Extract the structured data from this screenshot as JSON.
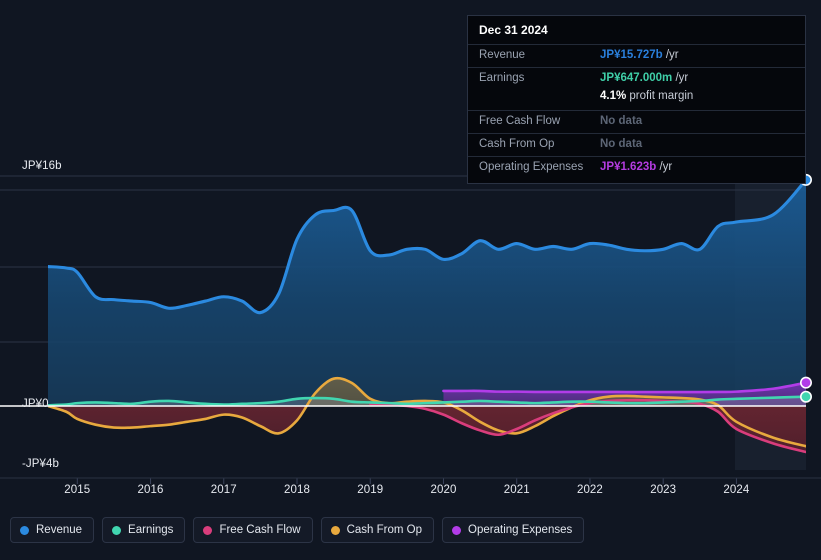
{
  "tooltip": {
    "title": "Dec 31 2024",
    "rows": [
      {
        "key": "Revenue",
        "value": "JP¥15.727b",
        "unit": "/yr",
        "color": "#2a7fdb",
        "nodata": false
      },
      {
        "key": "Earnings",
        "value": "JP¥647.000m",
        "unit": "/yr",
        "color": "#3fcfa8",
        "nodata": false
      },
      {
        "key": "",
        "value": "4.1%",
        "unit": "profit margin",
        "color": "#ffffff",
        "nodata": false,
        "sub": true
      },
      {
        "key": "Free Cash Flow",
        "value": "No data",
        "unit": "",
        "color": "#5d6676",
        "nodata": true
      },
      {
        "key": "Cash From Op",
        "value": "No data",
        "unit": "",
        "color": "#5d6676",
        "nodata": true
      },
      {
        "key": "Operating Expenses",
        "value": "JP¥1.623b",
        "unit": "/yr",
        "color": "#b43ce0",
        "nodata": false
      }
    ]
  },
  "legend": [
    {
      "label": "Revenue",
      "color": "#2b8ae0"
    },
    {
      "label": "Earnings",
      "color": "#41d6b0"
    },
    {
      "label": "Free Cash Flow",
      "color": "#d93d7c"
    },
    {
      "label": "Cash From Op",
      "color": "#e8a93e"
    },
    {
      "label": "Operating Expenses",
      "color": "#b23ce8"
    }
  ],
  "axis": {
    "y_top_label": "JP¥16b",
    "y_zero_label": "JP¥0",
    "y_bottom_label": "-JP¥4b",
    "x_labels": [
      "2015",
      "2016",
      "2017",
      "2018",
      "2019",
      "2020",
      "2021",
      "2022",
      "2023",
      "2024"
    ]
  },
  "chart_data": {
    "type": "area",
    "title": "",
    "xlabel": "",
    "ylabel": "JP¥",
    "ylim": [
      -4,
      16
    ],
    "ytick_values": [
      16,
      0,
      -4
    ],
    "ytick_labels": [
      "JP¥16b",
      "JP¥0",
      "-JP¥4b"
    ],
    "grid": true,
    "legend_position": "bottom",
    "x_tick_labels": [
      "2015",
      "2016",
      "2017",
      "2018",
      "2019",
      "2020",
      "2021",
      "2022",
      "2023",
      "2024"
    ],
    "x": [
      2014.6,
      2014.85,
      2015.0,
      2015.25,
      2015.5,
      2015.75,
      2016.0,
      2016.25,
      2016.5,
      2016.75,
      2017.0,
      2017.25,
      2017.5,
      2017.75,
      2018.0,
      2018.25,
      2018.5,
      2018.75,
      2019.0,
      2019.25,
      2019.5,
      2019.75,
      2020.0,
      2020.25,
      2020.5,
      2020.75,
      2021.0,
      2021.25,
      2021.5,
      2021.75,
      2022.0,
      2022.25,
      2022.5,
      2022.75,
      2023.0,
      2023.25,
      2023.5,
      2023.75,
      2024.0,
      2024.5,
      2024.95
    ],
    "series": [
      {
        "name": "Revenue",
        "color": "#2b8ae0",
        "filled": true,
        "values": [
          9.7,
          9.6,
          9.3,
          7.6,
          7.4,
          7.3,
          7.2,
          6.8,
          7.0,
          7.3,
          7.6,
          7.3,
          6.5,
          7.8,
          11.6,
          13.3,
          13.6,
          13.6,
          10.8,
          10.5,
          10.9,
          10.9,
          10.2,
          10.6,
          11.5,
          10.9,
          11.3,
          10.9,
          11.1,
          10.9,
          11.3,
          11.2,
          10.9,
          10.8,
          10.9,
          11.3,
          10.9,
          12.5,
          12.8,
          13.3,
          15.727
        ]
      },
      {
        "name": "Earnings",
        "color": "#41d6b0",
        "filled": false,
        "values": [
          0.05,
          0.1,
          0.2,
          0.25,
          0.2,
          0.15,
          0.3,
          0.35,
          0.25,
          0.15,
          0.1,
          0.15,
          0.2,
          0.3,
          0.5,
          0.55,
          0.5,
          0.3,
          0.25,
          0.2,
          0.15,
          0.2,
          0.25,
          0.3,
          0.35,
          0.3,
          0.25,
          0.2,
          0.25,
          0.3,
          0.3,
          0.25,
          0.2,
          0.2,
          0.25,
          0.3,
          0.35,
          0.45,
          0.5,
          0.58,
          0.647
        ]
      },
      {
        "name": "Free Cash Flow",
        "color": "#d93d7c",
        "filled": true,
        "values": [
          null,
          null,
          null,
          null,
          null,
          null,
          null,
          null,
          null,
          null,
          null,
          null,
          null,
          null,
          null,
          null,
          null,
          null,
          0.15,
          0.1,
          0.0,
          -0.2,
          -0.6,
          -1.2,
          -1.7,
          -2.0,
          -1.6,
          -1.0,
          -0.5,
          -0.1,
          0.2,
          0.35,
          0.4,
          0.4,
          0.35,
          0.3,
          0.15,
          -0.4,
          -1.6,
          -2.6,
          -3.2
        ]
      },
      {
        "name": "Cash From Op",
        "color": "#e8a93e",
        "filled": true,
        "values": [
          0.0,
          -0.4,
          -0.9,
          -1.3,
          -1.5,
          -1.5,
          -1.4,
          -1.3,
          -1.1,
          -0.9,
          -0.6,
          -0.8,
          -1.4,
          -1.9,
          -1.0,
          0.9,
          1.9,
          1.6,
          0.5,
          0.2,
          0.3,
          0.35,
          0.25,
          -0.3,
          -1.1,
          -1.7,
          -1.9,
          -1.4,
          -0.7,
          -0.1,
          0.4,
          0.65,
          0.7,
          0.65,
          0.6,
          0.55,
          0.45,
          0.05,
          -1.1,
          -2.2,
          -2.8
        ]
      },
      {
        "name": "Operating Expenses",
        "color": "#b23ce8",
        "filled": true,
        "values": [
          null,
          null,
          null,
          null,
          null,
          null,
          null,
          null,
          null,
          null,
          null,
          null,
          null,
          null,
          null,
          null,
          null,
          null,
          null,
          null,
          null,
          null,
          1.05,
          1.05,
          1.05,
          1.0,
          1.0,
          0.98,
          0.98,
          0.98,
          0.98,
          0.98,
          0.97,
          0.97,
          0.97,
          0.97,
          0.97,
          0.98,
          1.0,
          1.2,
          1.623
        ]
      }
    ]
  }
}
